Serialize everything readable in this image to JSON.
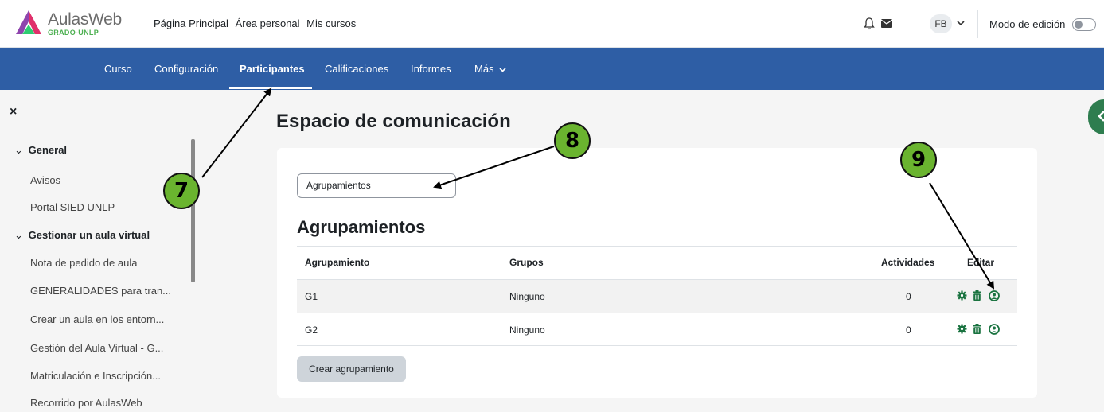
{
  "brand": {
    "name": "AulasWeb",
    "sub": "GRADO-UNLP"
  },
  "topnav": [
    "Página Principal",
    "Área personal",
    "Mis cursos"
  ],
  "user": {
    "initials": "FB"
  },
  "edit_mode_label": "Modo de edición",
  "secnav": [
    "Curso",
    "Configuración",
    "Participantes",
    "Calificaciones",
    "Informes",
    "Más"
  ],
  "drawer": {
    "close": "×",
    "sections": [
      {
        "label": "General",
        "items": [
          "Avisos",
          "Portal SIED UNLP"
        ]
      },
      {
        "label": "Gestionar un aula virtual",
        "items": [
          "Nota de pedido de aula",
          "GENERALIDADES para tran...",
          "Crear un aula en los entorn...",
          "Gestión del Aula Virtual - G...",
          "Matriculación e Inscripción...",
          "Recorrido por AulasWeb"
        ]
      }
    ]
  },
  "page_title": "Espacio de comunicación",
  "selector_value": "Agrupamientos",
  "section_title": "Agrupamientos",
  "table": {
    "headers": [
      "Agrupamiento",
      "Grupos",
      "Actividades",
      "Editar"
    ],
    "rows": [
      {
        "name": "G1",
        "groups": "Ninguno",
        "activities": "0"
      },
      {
        "name": "G2",
        "groups": "Ninguno",
        "activities": "0"
      }
    ]
  },
  "create_button": "Crear agrupamiento",
  "callouts": [
    "7",
    "8",
    "9"
  ],
  "colors": {
    "navbar": "#2e5ea5",
    "accent_green": "#1a7340",
    "badge": "#6ab42f"
  },
  "icons": [
    "gear-icon",
    "trash-icon",
    "user-icon",
    "bell-icon",
    "envelope-icon",
    "chevron-down-icon",
    "close-icon"
  ]
}
